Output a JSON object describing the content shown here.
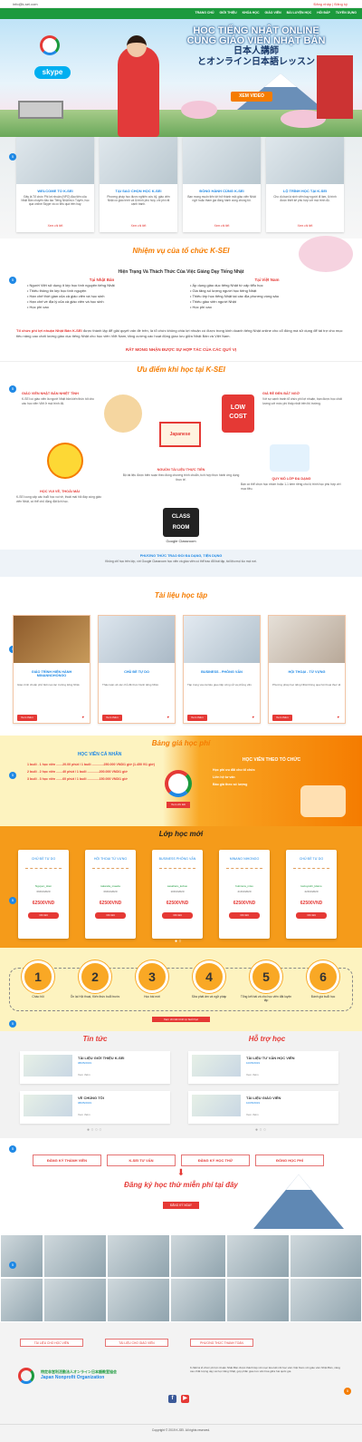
{
  "topbar": {
    "email": "info@k-sei.com",
    "login": "Đăng nhập",
    "register": "Đăng ký"
  },
  "nav": {
    "items": [
      "TRANG CHỦ",
      "GIỚI THIỆU",
      "KHÓA HỌC",
      "GIÁO VIÊN",
      "BÀI LUYỆN HỌC",
      "HỎI ĐÁP",
      "TUYỂN DỤNG"
    ]
  },
  "hero": {
    "line1": "HỌC TIẾNG NHẬT ONLINE",
    "line2": "CÙNG GIÁO VIÊN NHẬT BẢN",
    "jp1": "日本人講師",
    "jp2": "とオンライン日本語レッスン",
    "video": "XEM VIDEO",
    "skype": "skype"
  },
  "intro_cards": [
    {
      "title": "WELCOME TO K-SEI",
      "desc": "Đây là Tổ chức Phi lợi nhuận (NPO) đầu tiên của Nhật Bản chuyên đào tạo Tiếng Nhật trực Tuyến, học qua online Skype và có tiêu quả trên hay.",
      "more": "Xem chi tiết"
    },
    {
      "title": "TẠI SAO CHỌN HỌC K-SEI",
      "desc": "Phương pháp học được nghiên cứu kỹ, giáo viên Nhật có giáo trình và lộ trình phù hợp, chi phí rất cạnh tranh.",
      "more": "Xem chi tiết"
    },
    {
      "title": "ĐỒNG HÀNH CÙNG K-SEI",
      "desc": "Bạn mong muốn tiến tới trở thành một giáo viên Nhật ngữ hoặc tham gia đồng hành cùng chúng tôi.",
      "more": "Xem chi tiết"
    },
    {
      "title": "LỘ TRÌNH HỌC TẠI K-SEI",
      "desc": "Cho dù bạn là sinh viên hay người đi làm, lộ trình được thiết kế phù hợp với mọi trình độ.",
      "more": "Xem chi tiết"
    }
  ],
  "mission": {
    "title": "Nhiệm vụ của tổ chức K-SEI",
    "sub": "Hiện Trạng Và Thách Thức Của Việc Giảng Dạy Tiếng Nhật",
    "left_head": "Tại Nhật Bản",
    "right_head": "Tại Việt Nam",
    "left": [
      "Người Việt sử dụng ít lớp học tình nguyện tiếng Nhật",
      "Thiếu thông tin lớp học tình nguyện",
      "Hạn chế thời gian của cả giáo viên và học sinh",
      "Hạn chế về địa lý của cả giáo viên và học sinh",
      "Học phí cao"
    ],
    "right": [
      "Áp dụng giáo dục tiếng Nhật từ cấp tiểu học",
      "Gia tăng số lượng người học tiếng Nhật",
      "Thiếu lớp học tiếng Nhật tại các địa phương vùng sâu",
      "Thiếu giáo viên người Nhật",
      "Học phí cao"
    ],
    "para_hl": "Tổ chức phi lợi nhuận Nhật Bản K-SEI",
    "para": " được thành lập để giải quyết vấn đề trên, là tổ chức không chia lợi nhuận có được trong kinh doanh tiếng Nhật online cho cổ đông mà sử dụng để tái trợ cho mục tiêu nâng cao chất lượng giáo dục tiếng Nhật cho học viên Việt Nam, tăng cường các hoạt động giao lưu giữa Nhật Bản và Việt Nam.",
    "support": "RẤT MONG NHẬN ĐƯỢC SỰ HỢP TÁC CỦA CÁC QUÝ VỊ"
  },
  "advantages": {
    "title": "Ưu điểm khi học tại K-SEI",
    "f1_t": "GIÁO VIÊN NHẬT BẢN NHIỆT TÌNH",
    "f1_d": "K-SEI có giáo viên là người Nhật bản kiến thức tốt cho các học viên Việt ở mọi trình độ.",
    "f2_t": "GIÁ RẺ ĐẾN BẤT NGỜ",
    "f2_d": "Với sự cạnh tranh tổ chức phi lợi nhuận, bạn được học chất lượng với mức phí thấp nhất trên thị trường.",
    "f3_t": "HỌC VUI VẺ, THOẢI MÁI",
    "f3_d": "K-SEI cung cấp các buổi học vui vẻ, thoải mái hỏi đáp cùng giáo viên Nhật, có thể chủ động đặt lịch học.",
    "f4_t": "QUY MÔ LỚP ĐA DẠNG",
    "f4_d": "Bạn có thể chọn học nhóm hoặc 1-1 kèm riêng cho lộ trình học phù hợp với mục tiêu.",
    "f5_t": "NGUỒN TÀI LIỆU THỰC TIỄN",
    "f5_d": "Bộ tài liệu được biên soạn theo đúng chương trình chuẩn, tích hợp thực hành ứng dụng thực tế.",
    "low": "LOW COST",
    "jp": "Japanese",
    "classroom": "CLASS ROOM",
    "gc": "Google Classroom",
    "f6_t": "PHƯƠNG THỨC TRAO ĐỔI ĐA DẠNG, TIỆN DỤNG",
    "f6_d": "Không chỉ học trên lớp, với Google Classroom học viên và giáo viên có thể trao đổi bài tập, tài liệu mọi lúc mọi nơi."
  },
  "materials": {
    "title": "Tài liệu học tập",
    "items": [
      {
        "title": "GIÁO TRÌNH HIỆN HÀNH MINANNOHONGO",
        "desc": "Giáo trình chuẩn phổ biến tại các trường tiếng Nhật.",
        "btn": "Xem thêm",
        "heart": "♥"
      },
      {
        "title": "CHỦ ĐỀ TỰ DO",
        "desc": "Thảo luận về các chủ đề thực hành tiếng Nhật.",
        "btn": "Xem thêm",
        "heart": "♥"
      },
      {
        "title": "BUSINESS - PHỎNG VẤN",
        "desc": "Tập trung vào tài liệu giao tiếp công sở và phỏng vấn.",
        "btn": "Xem thêm",
        "heart": "♥"
      },
      {
        "title": "HỘI THOẠI - TỪ VỰNG",
        "desc": "Phương pháp học tiếng Nhật thông qua hội thoại thực tế.",
        "btn": "Xem thêm",
        "heart": "♥"
      }
    ]
  },
  "pricing": {
    "title": "Bảng giá học phí",
    "personal": "HỌC VIÊN CÁ NHÂN",
    "org": "HỌC VIÊN THEO TỔ CHỨC",
    "rows": [
      "1 buổi . 1 học viên .......20.00 phút / 1 buổi .............250.000 VND/1 giờ (1.450 ¥/1 giờ)",
      "2 buổi . 2 học viên .......40 phút / 1 buổi .............200.000 VND/1 giờ",
      "3 buổi . 3 học viên .......60 phút / 1 buổi .............150.000 VND/1 giờ"
    ],
    "org_rows": [
      "Học phí ưu đãi cho tổ chức",
      "Liên hệ tư vấn",
      "Báo giá theo số lượng"
    ],
    "btn": "Xem chi tiết"
  },
  "classes": {
    "title": "Lớp học mới",
    "items": [
      {
        "title": "CHỦ ĐỀ TỰ DO",
        "user": "Nguyen_Hien",
        "date": "09/04/2020",
        "price": "62500VND",
        "btn": "Chi tiết"
      },
      {
        "title": "HỘI THOẠI TỪ VỰNG",
        "user": "takanda_maeda",
        "date": "09/04/2020",
        "price": "62500VND",
        "btn": "Chi tiết"
      },
      {
        "title": "BUSINESS PHỎNG VẤN",
        "user": "sasaharu_kobuo",
        "date": "10/04/2020",
        "price": "62500VND",
        "btn": "Chi tiết"
      },
      {
        "title": "MINANO NIHONGO",
        "user": "hutimura_miso",
        "date": "21/04/2020",
        "price": "62500VND",
        "btn": "Chi tiết"
      },
      {
        "title": "CHỦ ĐỀ TỰ DO",
        "user": "kazuyoshi_kitano",
        "date": "22/04/2020",
        "price": "62500VND",
        "btn": "Chi tiết"
      }
    ]
  },
  "steps": {
    "items": [
      {
        "n": "1",
        "label": "Chào hỏi"
      },
      {
        "n": "2",
        "label": "Ôn lại Hội thoại, Kiến thức buổi trước"
      },
      {
        "n": "3",
        "label": "Học bài mới"
      },
      {
        "n": "4",
        "label": "Sửa phát âm và ngữ pháp"
      },
      {
        "n": "5",
        "label": "Tổng kết bài và cho học viên đặt luyện tập"
      },
      {
        "n": "6",
        "label": "Đánh giá buổi học"
      }
    ],
    "btn": "Xem chi tiết trình tự buổi học"
  },
  "news": {
    "title": "Tin tức",
    "items": [
      {
        "title": "TÀI LIỆU GIỚI THIỆU K-SEI",
        "date": "08/05/2019",
        "more": "Xem thêm"
      },
      {
        "title": "VỀ CHÚNG TÔI",
        "date": "08/05/2019",
        "more": "Xem thêm"
      }
    ]
  },
  "support": {
    "title": "Hỗ trợ học",
    "items": [
      {
        "title": "TÀI LIỆU TƯ VẤN HỌC VIÊN",
        "date": "10/05/2019",
        "more": "Xem thêm"
      },
      {
        "title": "TÀI LIỆU GIÁO VIÊN",
        "date": "10/05/2019",
        "more": "Xem thêm"
      }
    ]
  },
  "flow": {
    "items": [
      "ĐĂNG KÝ THÀNH VIÊN",
      "K-SEI TƯ VẤN",
      "ĐĂNG KÝ HỌC THỬ",
      "ĐÓNG HỌC PHÍ"
    ],
    "free": "Đăng ký học thử miễn phí tại đây",
    "btn": "ĐĂNG KÝ NGAY"
  },
  "footer": {
    "btns": [
      "TÀI LIỆU CHO HỌC VIÊN",
      "TÀI LIỆU CHO GIÁO VIÊN",
      "PHƯƠNG THỨC THANH TOÁN"
    ],
    "org1": "特定非営利活動法人オンライン日本語教室協会",
    "org2": "Japan Nonprofit Organization",
    "desc": "K-SEI là tổ chức phi lợi nhuận Nhật Bản được thành lập với mục tiêu kết nối học viên Việt Nam với giáo viên Nhật Bản, nâng cao chất lượng dạy và học tiếng Nhật, góp phần giao lưu văn hóa giữa hai quốc gia.",
    "fb": "f",
    "yt": "▶",
    "copyright": "Copyright © 2019 K-SEI. All rights reserved."
  },
  "badges": {
    "b1": "5",
    "b2": "5",
    "b3": "5",
    "b4": "5",
    "b5": "5",
    "b6": "5",
    "b7": "5",
    "b8": "5",
    "b9": "5",
    "b10": "5"
  }
}
